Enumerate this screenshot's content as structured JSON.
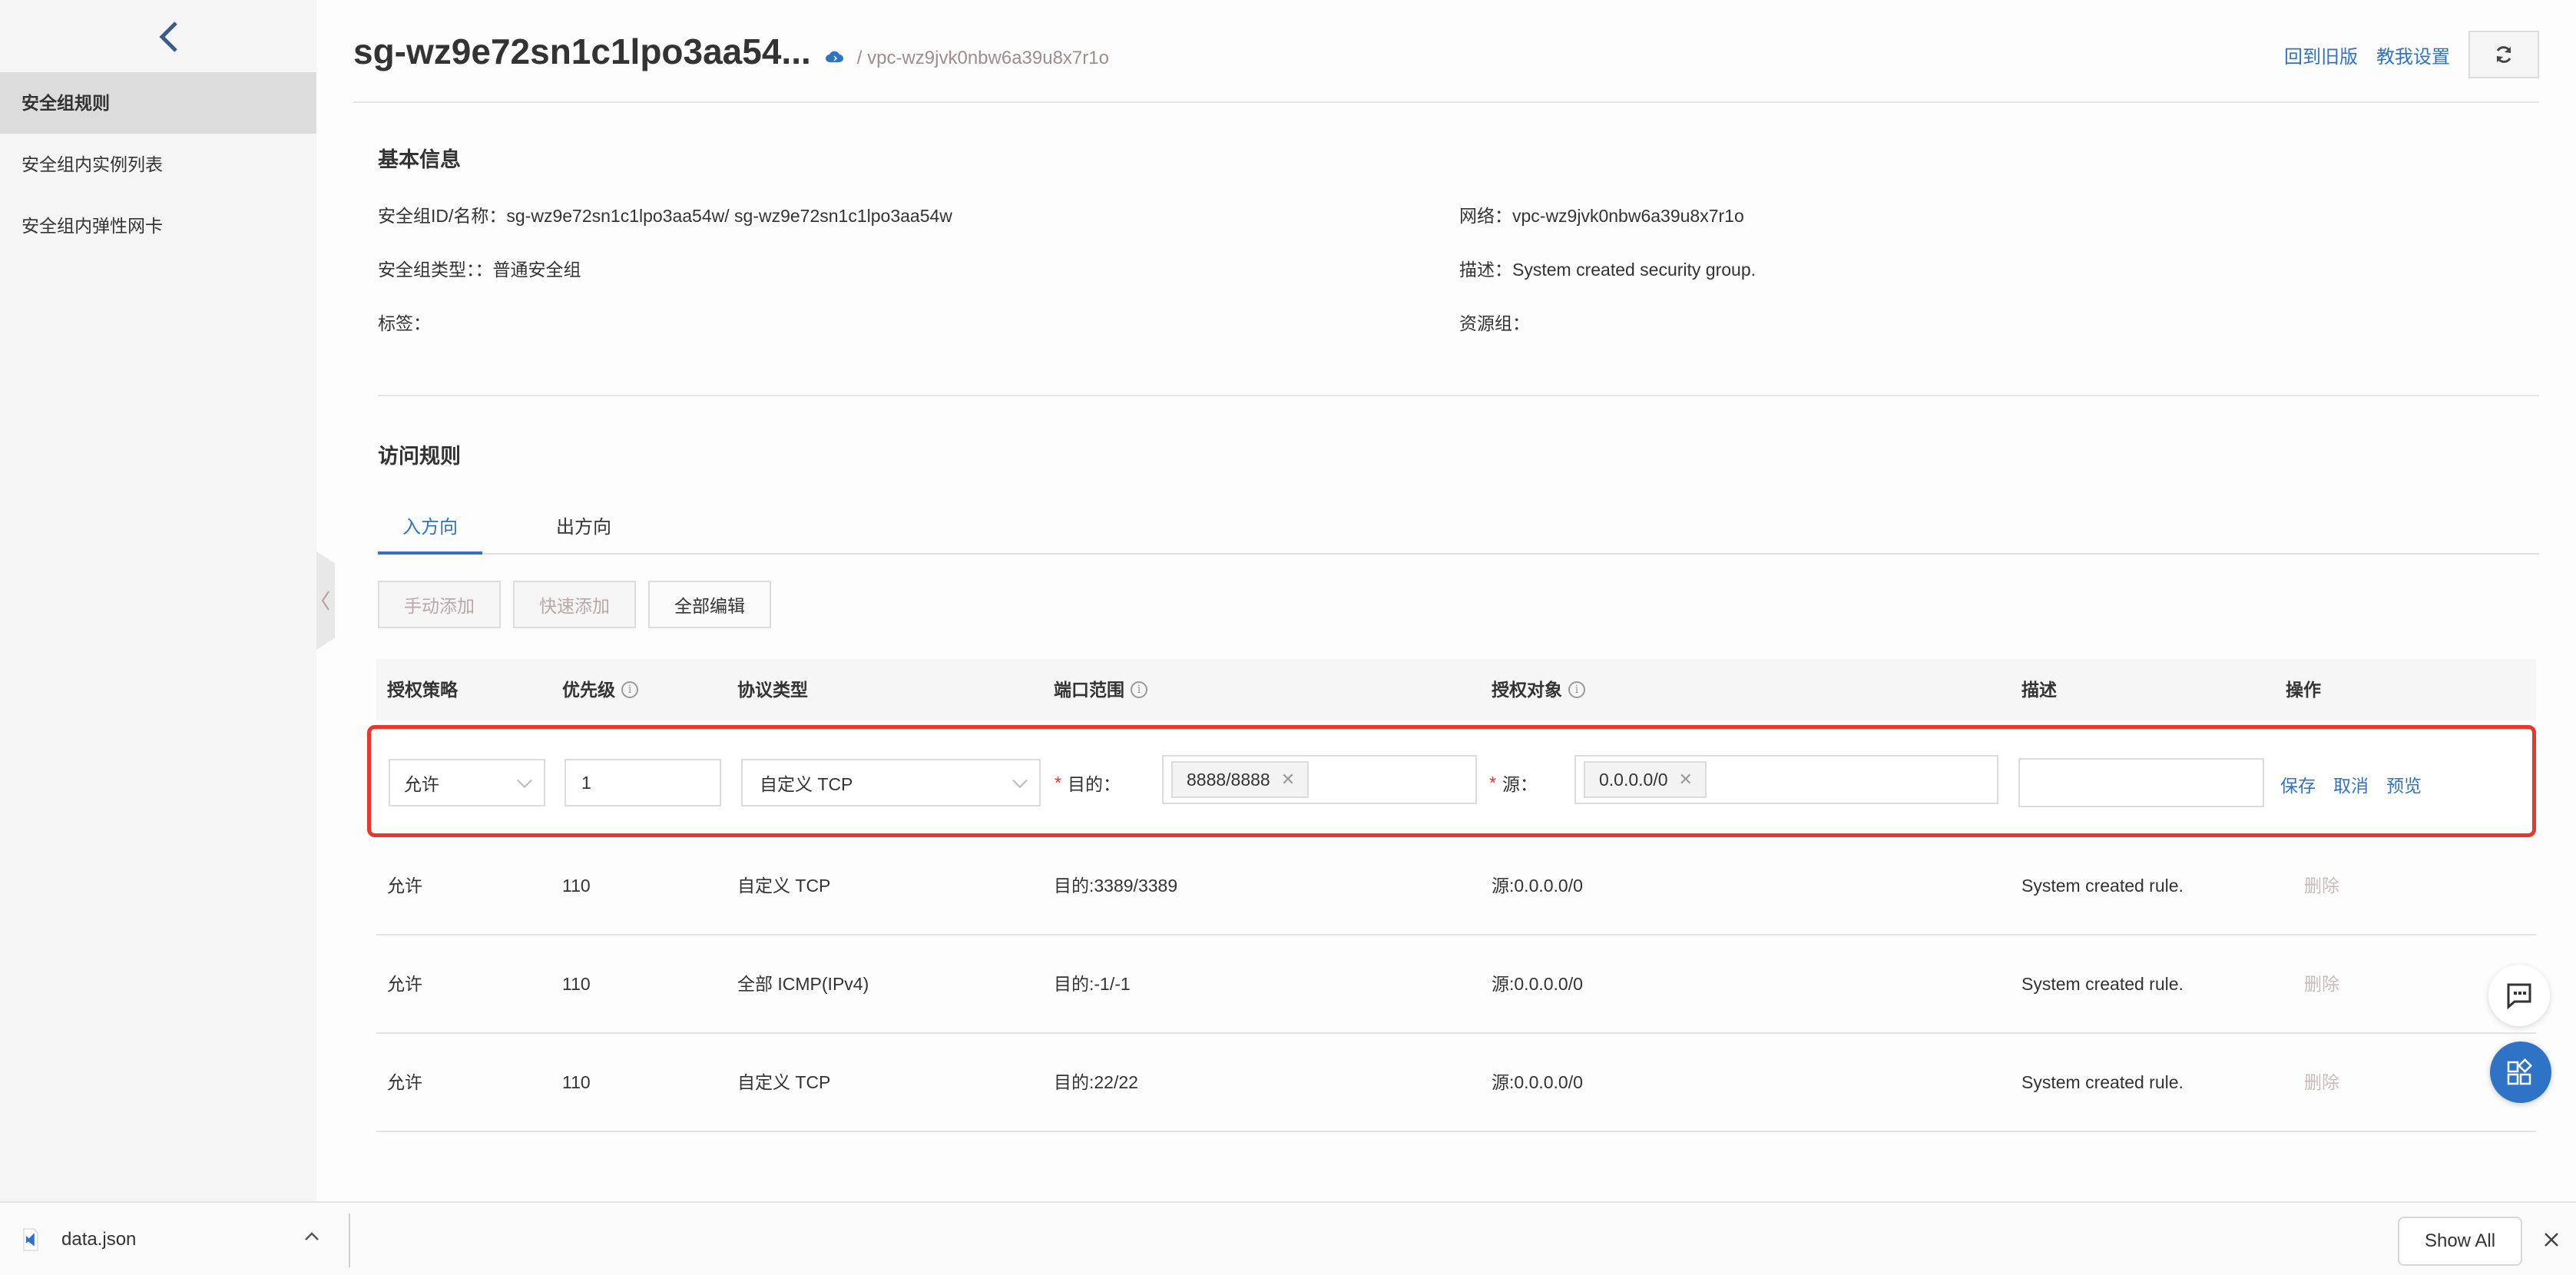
{
  "sidebar": {
    "back_icon": "chevron-left-icon",
    "items": [
      {
        "label": "安全组规则",
        "active": true
      },
      {
        "label": "安全组内实例列表",
        "active": false
      },
      {
        "label": "安全组内弹性网卡",
        "active": false
      }
    ]
  },
  "header": {
    "title": "sg-wz9e72sn1c1lpo3aa54...",
    "cloud_icon": "cloud-icon",
    "vpc_link": "/ vpc-wz9jvk0nbw6a39u8x7r1o",
    "actions": {
      "back_to_old": "回到旧版",
      "teach_me": "教我设置",
      "refresh_icon": "refresh-icon"
    }
  },
  "basic_info": {
    "title": "基本信息",
    "left": [
      {
        "label": "安全组ID/名称：",
        "value": "sg-wz9e72sn1c1lpo3aa54w/ sg-wz9e72sn1c1lpo3aa54w"
      },
      {
        "label": "安全组类型：：",
        "value": "普通安全组"
      },
      {
        "label": "标签：",
        "value": ""
      }
    ],
    "right": [
      {
        "label": "网络：",
        "value": "vpc-wz9jvk0nbw6a39u8x7r1o"
      },
      {
        "label": "描述：",
        "value": "System created security group."
      },
      {
        "label": "资源组：",
        "value": ""
      }
    ]
  },
  "access_rules": {
    "title": "访问规则",
    "tabs": [
      {
        "label": "入方向",
        "active": true
      },
      {
        "label": "出方向",
        "active": false
      }
    ],
    "toolbar": {
      "manual_add": "手动添加",
      "quick_add": "快速添加",
      "edit_all": "全部编辑"
    },
    "columns": [
      "授权策略",
      "优先级",
      "协议类型",
      "端口范围",
      "授权对象",
      "描述",
      "操作"
    ],
    "edit_row": {
      "policy": "允许",
      "priority": "1",
      "protocol": "自定义 TCP",
      "port_label": "目的：",
      "port_tag": "8888/8888",
      "source_label": "源：",
      "source_tag": "0.0.0.0/0",
      "description": "",
      "actions": {
        "save": "保存",
        "cancel": "取消",
        "preview": "预览"
      }
    },
    "rows": [
      {
        "policy": "允许",
        "priority": "110",
        "protocol": "自定义 TCP",
        "port": "目的:3389/3389",
        "source": "源:0.0.0.0/0",
        "description": "System created rule.",
        "action": "删除"
      },
      {
        "policy": "允许",
        "priority": "110",
        "protocol": "全部 ICMP(IPv4)",
        "port": "目的:-1/-1",
        "source": "源:0.0.0.0/0",
        "description": "System created rule.",
        "action": "删除"
      },
      {
        "policy": "允许",
        "priority": "110",
        "protocol": "自定义 TCP",
        "port": "目的:22/22",
        "source": "源:0.0.0.0/0",
        "description": "System created rule.",
        "action": "删除"
      }
    ]
  },
  "floating": {
    "chat_icon": "chat-icon",
    "apps_icon": "apps-icon"
  },
  "download_bar": {
    "file_name": "data.json",
    "show_all": "Show All"
  },
  "colors": {
    "accent": "#2f73c7",
    "highlight_border": "#e8382d",
    "disabled_text": "#b8a8a8"
  }
}
